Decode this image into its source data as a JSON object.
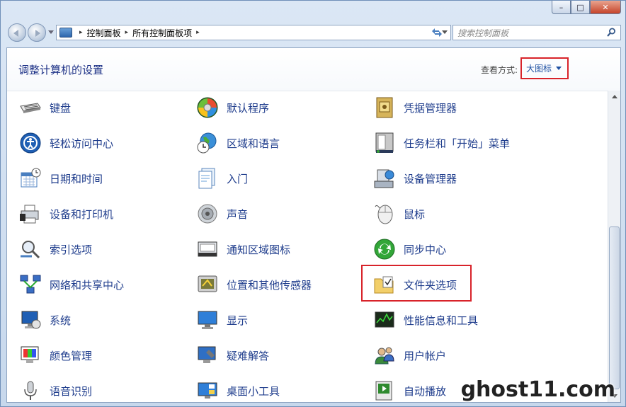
{
  "window": {
    "caption_min": "–",
    "caption_max": "□",
    "caption_close": "✕"
  },
  "address": {
    "crumbs": [
      "控制面板",
      "所有控制面板项"
    ],
    "sep": "▸"
  },
  "search": {
    "placeholder": "搜索控制面板",
    "icon": "search-icon"
  },
  "header": {
    "title": "调整计算机的设置",
    "view_label": "查看方式:",
    "view_value": "大图标"
  },
  "items": [
    {
      "label": "键盘",
      "icon": "keyboard-icon"
    },
    {
      "label": "默认程序",
      "icon": "default-programs-icon"
    },
    {
      "label": "凭据管理器",
      "icon": "credential-manager-icon"
    },
    {
      "label": "轻松访问中心",
      "icon": "ease-of-access-icon"
    },
    {
      "label": "区域和语言",
      "icon": "region-language-icon"
    },
    {
      "label": "任务栏和「开始」菜单",
      "icon": "taskbar-start-menu-icon"
    },
    {
      "label": "日期和时间",
      "icon": "date-time-icon"
    },
    {
      "label": "入门",
      "icon": "getting-started-icon"
    },
    {
      "label": "设备管理器",
      "icon": "device-manager-icon"
    },
    {
      "label": "设备和打印机",
      "icon": "devices-printers-icon"
    },
    {
      "label": "声音",
      "icon": "sound-icon"
    },
    {
      "label": "鼠标",
      "icon": "mouse-icon"
    },
    {
      "label": "索引选项",
      "icon": "indexing-options-icon"
    },
    {
      "label": "通知区域图标",
      "icon": "notification-area-icon"
    },
    {
      "label": "同步中心",
      "icon": "sync-center-icon"
    },
    {
      "label": "网络和共享中心",
      "icon": "network-sharing-icon"
    },
    {
      "label": "位置和其他传感器",
      "icon": "location-sensors-icon"
    },
    {
      "label": "文件夹选项",
      "icon": "folder-options-icon"
    },
    {
      "label": "系统",
      "icon": "system-icon"
    },
    {
      "label": "显示",
      "icon": "display-icon"
    },
    {
      "label": "性能信息和工具",
      "icon": "performance-icon"
    },
    {
      "label": "颜色管理",
      "icon": "color-management-icon"
    },
    {
      "label": "疑难解答",
      "icon": "troubleshooting-icon"
    },
    {
      "label": "用户帐户",
      "icon": "user-accounts-icon"
    },
    {
      "label": "语音识别",
      "icon": "speech-recognition-icon"
    },
    {
      "label": "桌面小工具",
      "icon": "desktop-gadgets-icon"
    },
    {
      "label": "自动播放",
      "icon": "autoplay-icon"
    }
  ],
  "watermark": "ghost11.com"
}
